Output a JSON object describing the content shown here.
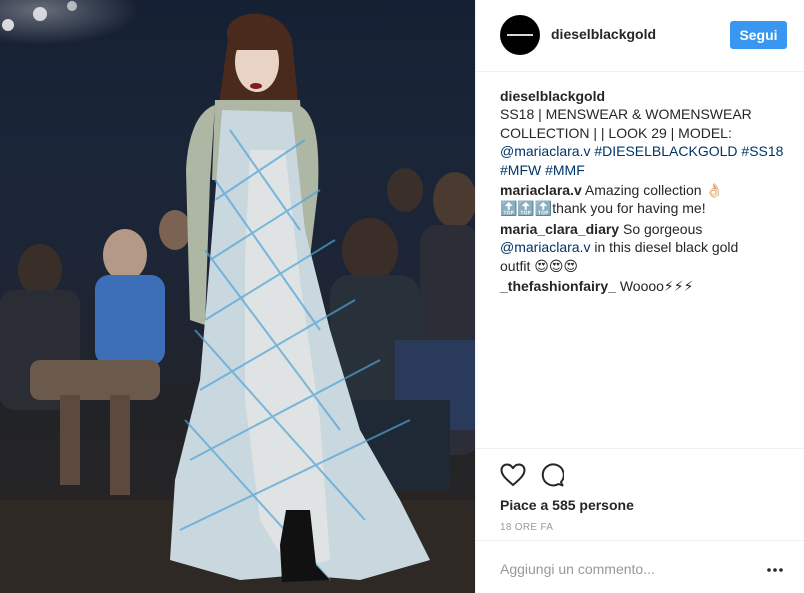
{
  "photo": {
    "description_icon": "runway-photo"
  },
  "header": {
    "username": "dieselblackgold",
    "follow_label": "Segui"
  },
  "caption": {
    "username": "dieselblackgold",
    "text_line1": "SS18 | MENSWEAR & WOMENSWEAR",
    "text_line2": "COLLECTION | | LOOK 29 | MODEL:",
    "tags_line3": [
      "@mariaclara.v",
      "#DIESELBLACKGOLD",
      "#SS18"
    ],
    "tags_line4": [
      "#MFW",
      "#MMF"
    ]
  },
  "comments": [
    {
      "username": "mariaclara.v",
      "text": "Amazing collection 👌🏻",
      "text2": "🔝🔝🔝thank you for having me!"
    },
    {
      "username": "maria_clara_diary",
      "text": "So gorgeous",
      "mention": "@mariaclara.v",
      "text2": "in this diesel black gold",
      "text3": "outfit 😍😍😍"
    },
    {
      "username": "_thefashionfairy_",
      "text": "Woooo⚡⚡⚡"
    }
  ],
  "actions": {
    "like_icon": "heart-icon",
    "comment_icon": "comment-icon",
    "likes_text": "Piace a 585 persone",
    "time_text": "18 ORE FA"
  },
  "comment_box": {
    "placeholder": "Aggiungi un commento...",
    "more_icon": "more-options-icon"
  },
  "colors": {
    "link": "#003569",
    "follow_button": "#3897f0",
    "muted": "#999999",
    "border": "#efefef"
  }
}
